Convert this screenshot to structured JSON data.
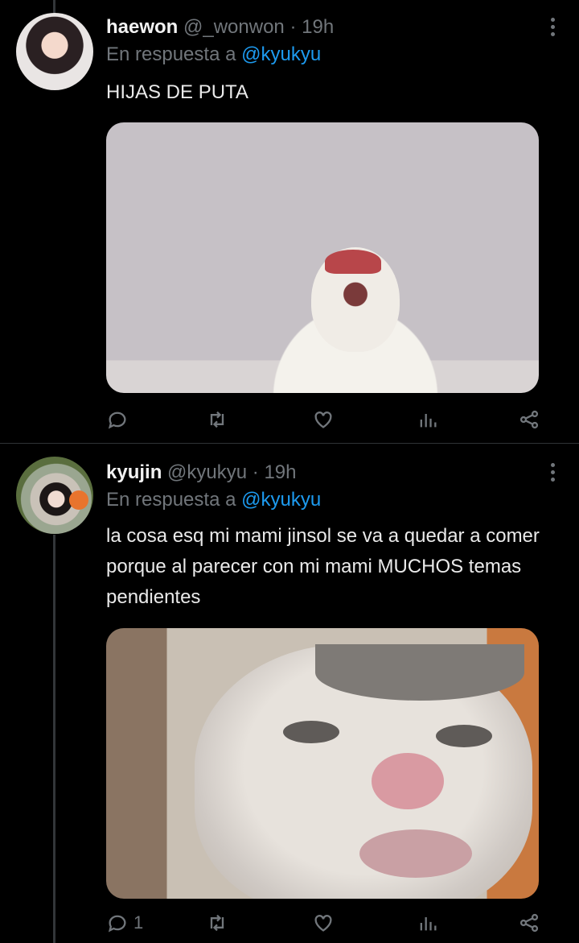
{
  "tweets": [
    {
      "name": "haewon",
      "handle": "@_wonwon",
      "separator": "·",
      "time": "19h",
      "reply_prefix": "En respuesta a",
      "reply_to": "@kyukyu",
      "text": "HIJAS DE PUTA",
      "actions": {
        "reply_count": "",
        "retweet_count": "",
        "like_count": ""
      }
    },
    {
      "name": "kyujin",
      "handle": "@kyukyu",
      "separator": "·",
      "time": "19h",
      "reply_prefix": "En respuesta a",
      "reply_to": "@kyukyu",
      "text": "la cosa esq mi mami jinsol se va a quedar a comer porque al parecer con mi mami MUCHOS temas pendientes",
      "actions": {
        "reply_count": "1",
        "retweet_count": "",
        "like_count": ""
      }
    }
  ],
  "colors": {
    "background": "#000000",
    "mention": "#1d9bf0",
    "muted": "#71767b"
  }
}
